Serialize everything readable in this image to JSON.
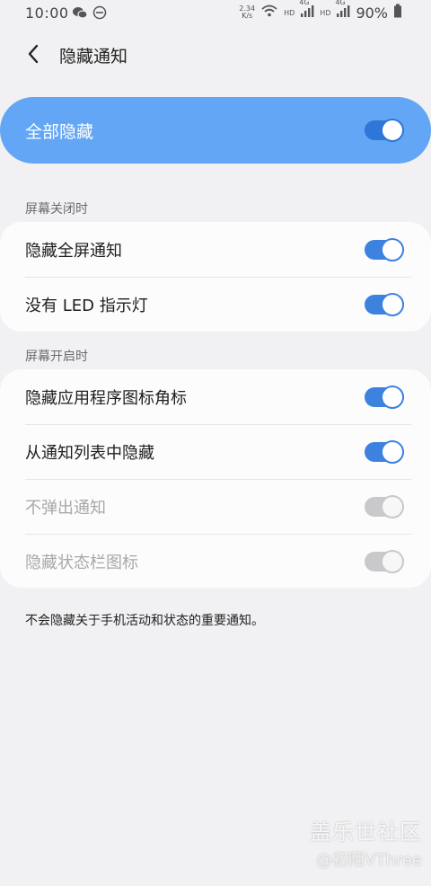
{
  "status_bar": {
    "time": "10:00",
    "net_speed_value": "2.34",
    "net_speed_unit": "K/s",
    "hd1": "HD",
    "lte1": "4G",
    "hd2": "HD",
    "lte2": "4G",
    "battery": "90%"
  },
  "header": {
    "title": "隐藏通知"
  },
  "master": {
    "label": "全部隐藏",
    "enabled": true
  },
  "section_screen_off": {
    "title": "屏幕关闭时",
    "items": [
      {
        "label": "隐藏全屏通知",
        "enabled": true,
        "disabled": false
      },
      {
        "label": "没有 LED 指示灯",
        "enabled": true,
        "disabled": false
      }
    ]
  },
  "section_screen_on": {
    "title": "屏幕开启时",
    "items": [
      {
        "label": "隐藏应用程序图标角标",
        "enabled": true,
        "disabled": false
      },
      {
        "label": "从通知列表中隐藏",
        "enabled": true,
        "disabled": false
      },
      {
        "label": "不弹出通知",
        "enabled": true,
        "disabled": true
      },
      {
        "label": "隐藏状态栏图标",
        "enabled": true,
        "disabled": true
      }
    ]
  },
  "footnote": "不会隐藏关于手机活动和状态的重要通知。",
  "watermark": {
    "brand": "盖乐世社区",
    "user": "@初陌VThree"
  },
  "colors": {
    "accent": "#3e82df",
    "master_bg": "#62a6f5",
    "disabled_toggle": "#c9c9cc"
  }
}
